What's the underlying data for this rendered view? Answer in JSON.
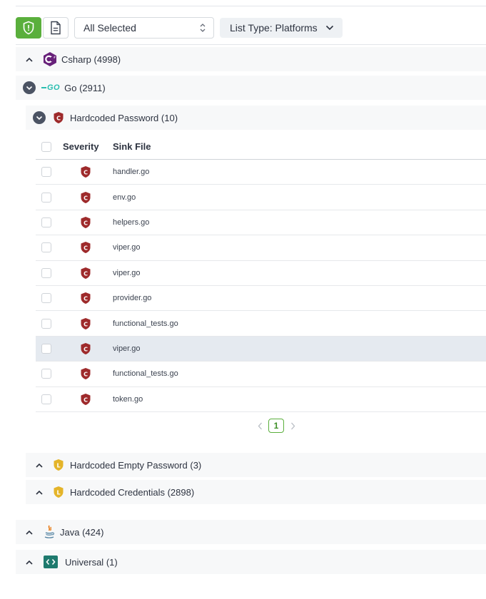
{
  "toolbar": {
    "select_value": "All Selected",
    "list_type_label": "List Type: Platforms"
  },
  "colors": {
    "accent_green": "#5aaf3c",
    "critical_red": "#9e2a2b",
    "low_yellow": "#e4b429",
    "csharp_purple": "#68217a",
    "go_blue": "#29beb0",
    "universal_teal": "#1e7a6e"
  },
  "languages": {
    "csharp": {
      "name": "Csharp",
      "count": "(4998)",
      "icon": "csharp-icon"
    },
    "go": {
      "name": "Go",
      "count": "(2911)",
      "icon": "go-icon",
      "logo_text": "GO"
    },
    "java": {
      "name": "Java",
      "count": "(424)",
      "icon": "java-icon"
    },
    "universal": {
      "name": "Universal",
      "count": "(1)",
      "icon": "code-icon"
    }
  },
  "issues": {
    "hardcoded_password": {
      "name": "Hardcoded Password",
      "count": "(10)",
      "severity_letter": "C"
    },
    "hardcoded_empty_password": {
      "name": "Hardcoded Empty Password",
      "count": "(3)",
      "severity_letter": "L"
    },
    "hardcoded_credentials": {
      "name": "Hardcoded Credentials",
      "count": "(2898)",
      "severity_letter": "L"
    }
  },
  "table": {
    "headers": {
      "severity": "Severity",
      "sink_file": "Sink File"
    },
    "rows": [
      {
        "severity": "C",
        "file": "handler.go"
      },
      {
        "severity": "C",
        "file": "env.go"
      },
      {
        "severity": "C",
        "file": "helpers.go"
      },
      {
        "severity": "C",
        "file": "viper.go"
      },
      {
        "severity": "C",
        "file": "viper.go"
      },
      {
        "severity": "C",
        "file": "provider.go"
      },
      {
        "severity": "C",
        "file": "functional_tests.go"
      },
      {
        "severity": "C",
        "file": "viper.go",
        "highlighted": true
      },
      {
        "severity": "C",
        "file": "functional_tests.go"
      },
      {
        "severity": "C",
        "file": "token.go"
      }
    ]
  },
  "pagination": {
    "current_page": "1"
  }
}
